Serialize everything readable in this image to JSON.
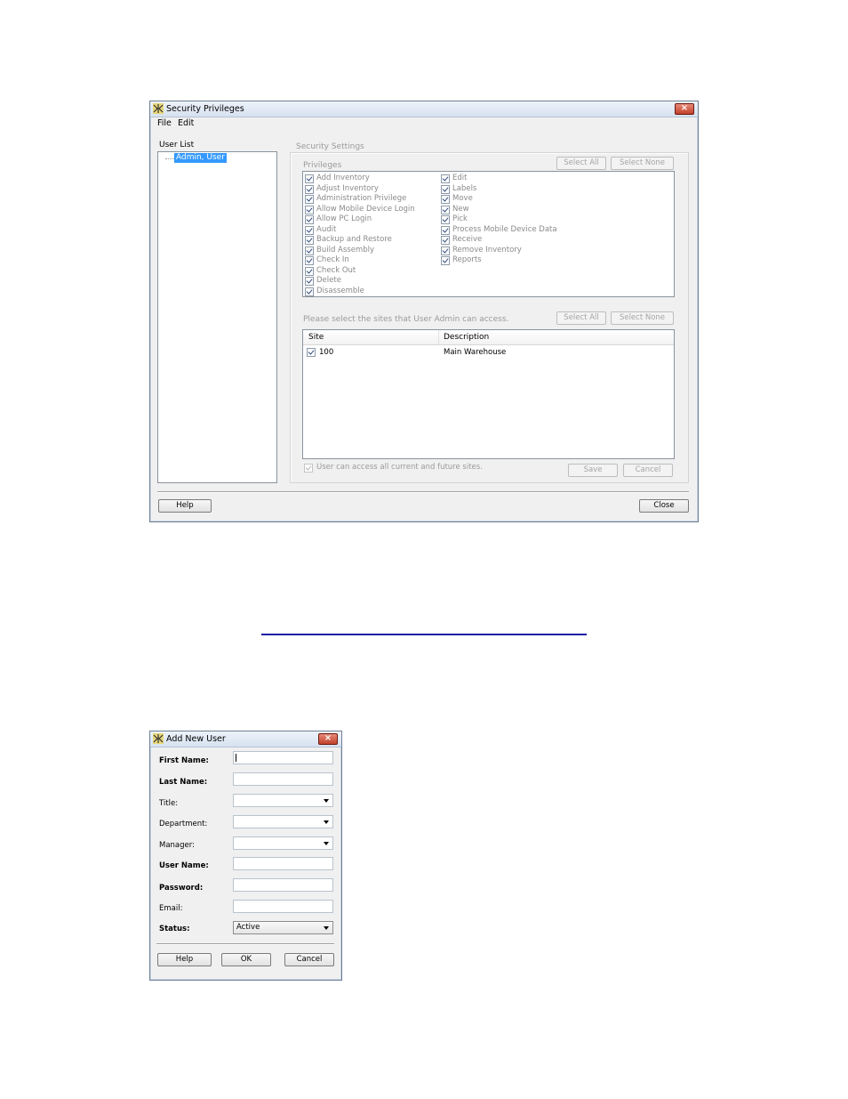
{
  "security_window": {
    "title": "Security Privileges",
    "menu": [
      "File",
      "Edit"
    ],
    "user_list_label": "User List",
    "selected_user": "Admin, User",
    "security_settings_label": "Security Settings",
    "privileges_label": "Privileges",
    "select_all_label": "Select All",
    "select_none_label": "Select None",
    "privileges_col1": [
      "Add Inventory",
      "Adjust Inventory",
      "Administration Privilege",
      "Allow Mobile Device Login",
      "Allow PC Login",
      "Audit",
      "Backup and Restore",
      "Build Assembly",
      "Check In",
      "Check Out",
      "Delete",
      "Disassemble"
    ],
    "privileges_col2": [
      "Edit",
      "Labels",
      "Move",
      "New",
      "Pick",
      "Process Mobile Device Data",
      "Receive",
      "Remove Inventory",
      "Reports"
    ],
    "sites_prompt": "Please select the sites that User Admin can access.",
    "sites_headers": [
      "Site",
      "Description"
    ],
    "sites_rows": [
      {
        "site": "100",
        "description": "Main Warehouse"
      }
    ],
    "all_sites_label": "User can access all current and future sites.",
    "save_label": "Save",
    "cancel_label": "Cancel",
    "help_label": "Help",
    "close_label": "Close"
  },
  "add_user_window": {
    "title": "Add New User",
    "fields": {
      "first_name": "First Name:",
      "last_name": "Last Name:",
      "title": "Title:",
      "department": "Department:",
      "manager": "Manager:",
      "user_name": "User Name:",
      "password": "Password:",
      "email": "Email:",
      "status": "Status:"
    },
    "status_value": "Active",
    "help_label": "Help",
    "ok_label": "OK",
    "cancel_label": "Cancel"
  },
  "colors": {
    "selection": "#3399ff",
    "link_line": "#1a1aa6"
  }
}
